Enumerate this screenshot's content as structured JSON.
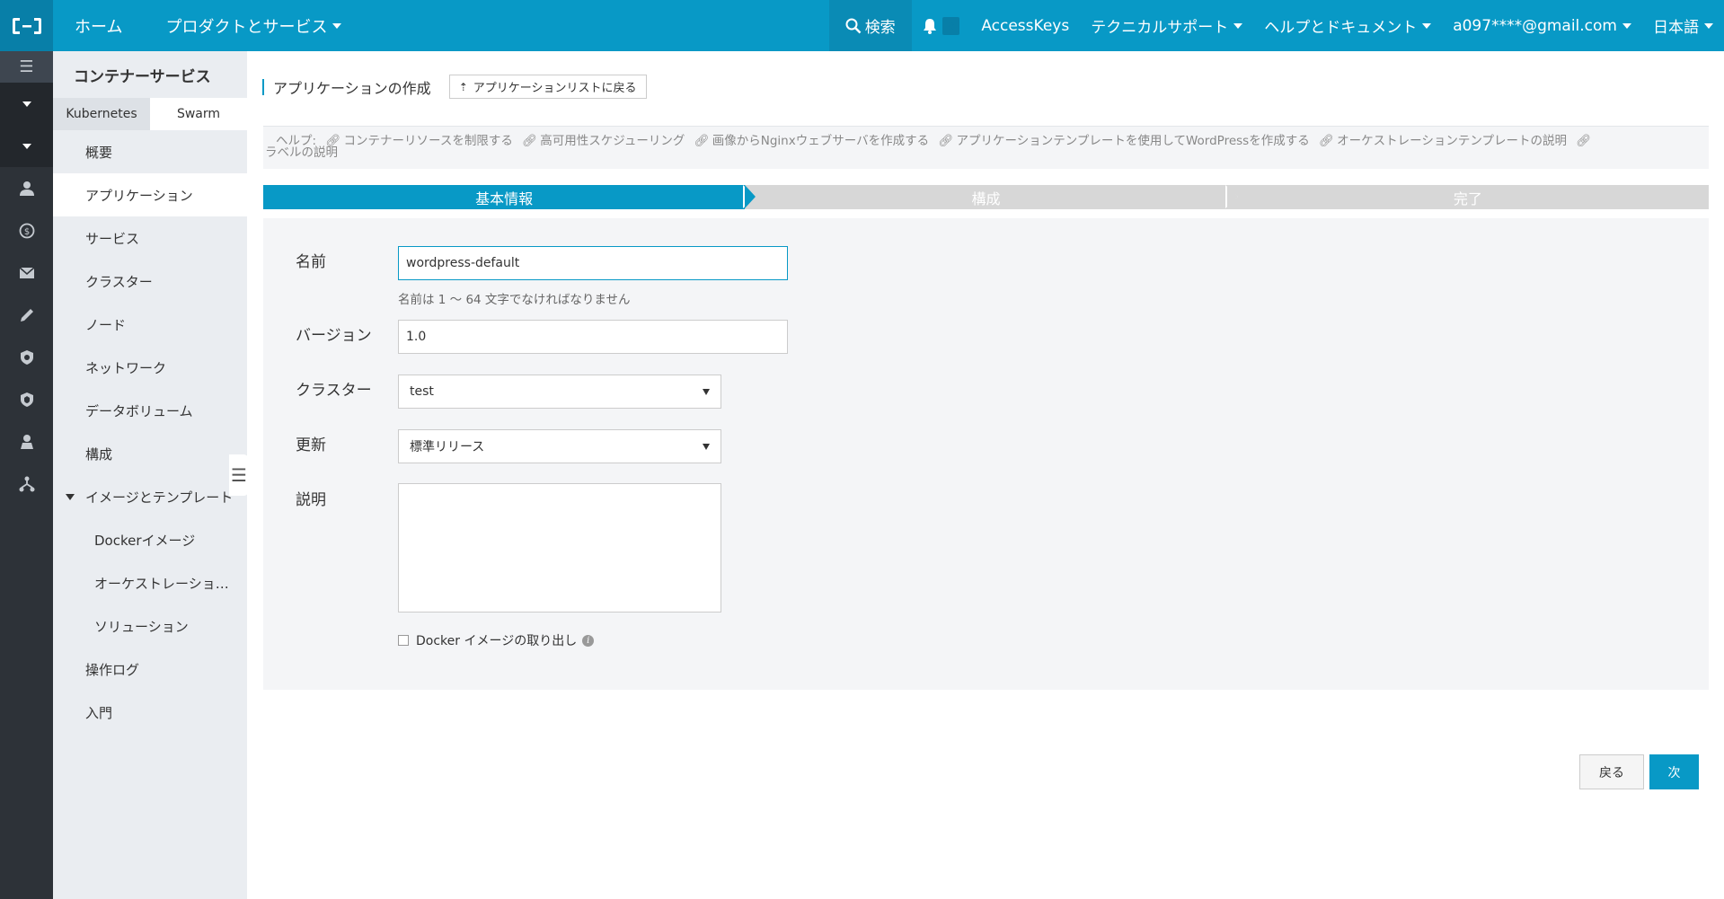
{
  "topbar": {
    "home": "ホーム",
    "products": "プロダクトとサービス",
    "search": "検索",
    "notifications_count": "0",
    "access_keys": "AccessKeys",
    "support": "テクニカルサポート",
    "help_docs": "ヘルプとドキュメント",
    "account": "a097****@gmail.com",
    "language": "日本語"
  },
  "sidebar": {
    "title": "コンテナーサービス",
    "tabs": [
      {
        "label": "Kubernetes",
        "active": false
      },
      {
        "label": "Swarm",
        "active": true
      }
    ],
    "items": [
      {
        "label": "概要"
      },
      {
        "label": "アプリケーション"
      },
      {
        "label": "サービス"
      },
      {
        "label": "クラスター"
      },
      {
        "label": "ノード"
      },
      {
        "label": "ネットワーク"
      },
      {
        "label": "データボリューム"
      },
      {
        "label": "構成"
      },
      {
        "label": "イメージとテンプレート"
      },
      {
        "label": "Dockerイメージ"
      },
      {
        "label": "オーケストレーショ…"
      },
      {
        "label": "ソリューション"
      },
      {
        "label": "操作ログ"
      },
      {
        "label": "入門"
      }
    ]
  },
  "page": {
    "title": "アプリケーションの作成",
    "back_to_list": "アプリケーションリストに戻る"
  },
  "help": {
    "label": "ヘルプ:",
    "links": [
      "コンテナーリソースを制限する",
      "高可用性スケジューリング",
      "画像からNginxウェブサーバを作成する",
      "アプリケーションテンプレートを使用してWordPressを作成する",
      "オーケストレーションテンプレートの説明",
      "ラベルの説明"
    ]
  },
  "steps": [
    "基本情報",
    "構成",
    "完了"
  ],
  "form": {
    "name_label": "名前",
    "name_value": "wordpress-default",
    "name_hint": "名前は 1 ～ 64 文字でなければなりません",
    "version_label": "バージョン",
    "version_value": "1.0",
    "cluster_label": "クラスター",
    "cluster_value": "test",
    "update_label": "更新",
    "update_value": "標準リリース",
    "description_label": "説明",
    "pull_image_label": "Docker イメージの取り出し",
    "pull_image_checked": false
  },
  "buttons": {
    "back": "戻る",
    "next": "次"
  },
  "colors": {
    "brand": "#0899c6",
    "icon_sidebar": "#2d3238",
    "sidebar_bg": "#eaedf1"
  }
}
